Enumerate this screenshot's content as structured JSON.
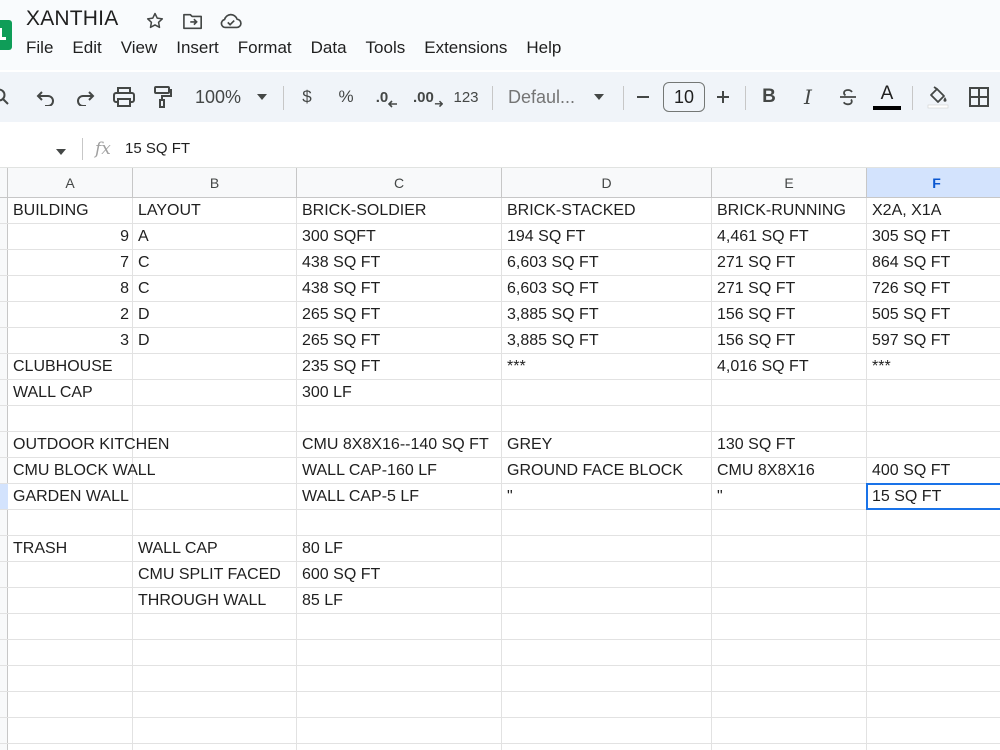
{
  "doc": {
    "title": "XANTHIA"
  },
  "menu": [
    "File",
    "Edit",
    "View",
    "Insert",
    "Format",
    "Data",
    "Tools",
    "Extensions",
    "Help"
  ],
  "toolbar": {
    "zoom": "100%",
    "currency": "$",
    "percent": "%",
    "dec_decrease": ".0",
    "dec_increase": ".00",
    "more_formats": "123",
    "font": "Defaul...",
    "font_size": "10",
    "bold": "B",
    "italic": "I",
    "text_color": "A",
    "icons": [
      "search-icon",
      "undo-icon",
      "redo-icon",
      "print-icon",
      "paint-format-icon",
      "zoom-dropdown-icon",
      "font-dropdown-icon",
      "minus-icon",
      "plus-icon",
      "strikethrough-icon",
      "fill-color-icon",
      "borders-icon"
    ]
  },
  "formula": {
    "fx": "fx",
    "value": "15 SQ FT"
  },
  "columns": [
    "A",
    "B",
    "C",
    "D",
    "E",
    "F"
  ],
  "selected_column": "F",
  "rows": [
    [
      "BUILDING",
      "LAYOUT",
      "BRICK-SOLDIER",
      "BRICK-STACKED",
      "BRICK-RUNNING",
      "X2A, X1A"
    ],
    [
      "9",
      "A",
      "300 SQFT",
      "194 SQ FT",
      "4,461 SQ FT",
      "305 SQ FT"
    ],
    [
      "7",
      "C",
      "438 SQ FT",
      "6,603 SQ FT",
      "271 SQ FT",
      "864 SQ FT"
    ],
    [
      "8",
      "C",
      "438 SQ FT",
      "6,603 SQ FT",
      "271 SQ FT",
      "726 SQ FT"
    ],
    [
      "2",
      "D",
      "265 SQ FT",
      "3,885 SQ FT",
      "156 SQ FT",
      "505 SQ FT"
    ],
    [
      "3",
      "D",
      "265 SQ FT",
      "3,885 SQ FT",
      "156 SQ FT",
      "597 SQ FT"
    ],
    [
      "CLUBHOUSE",
      "",
      "235 SQ FT",
      "***",
      "4,016 SQ FT",
      "***"
    ],
    [
      "WALL CAP",
      "",
      "300 LF",
      "",
      "",
      ""
    ],
    [
      "",
      "",
      "",
      "",
      "",
      ""
    ],
    [
      "OUTDOOR KITCHEN",
      "",
      "CMU 8X8X16--140 SQ FT",
      "GREY",
      "130 SQ FT",
      ""
    ],
    [
      "CMU  BLOCK WALL",
      "",
      "WALL CAP-160 LF",
      "GROUND FACE BLOCK",
      "CMU 8X8X16",
      "400 SQ FT"
    ],
    [
      "GARDEN WALL",
      "",
      "WALL CAP-5 LF",
      "\"",
      "\"",
      "15 SQ FT"
    ],
    [
      "",
      "",
      "",
      "",
      "",
      ""
    ],
    [
      "TRASH",
      "WALL CAP",
      "80 LF",
      "",
      "",
      ""
    ],
    [
      "",
      "CMU SPLIT FACED",
      "600 SQ FT",
      "",
      "",
      ""
    ],
    [
      "",
      "THROUGH WALL",
      "85 LF",
      "",
      "",
      ""
    ],
    [
      "",
      "",
      "",
      "",
      "",
      ""
    ],
    [
      "",
      "",
      "",
      "",
      "",
      ""
    ],
    [
      "",
      "",
      "",
      "",
      "",
      ""
    ],
    [
      "",
      "",
      "",
      "",
      "",
      ""
    ],
    [
      "",
      "",
      "",
      "",
      "",
      ""
    ]
  ],
  "colors": {
    "accent": "#1a73e8",
    "header_selected": "#d3e3fd",
    "logo": "#0f9d58"
  }
}
